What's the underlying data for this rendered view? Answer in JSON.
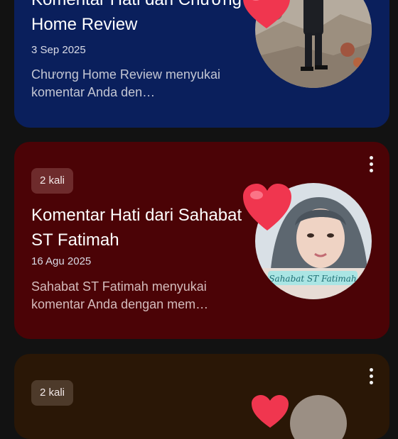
{
  "notifications": [
    {
      "title": "Komentar Hati dari Chương Home Review",
      "date": "3 Sep 2025",
      "description": "Chương Home Review menyukai komentar Anda den…",
      "avatar_icon": "avatar-man-on-rubble",
      "accent": "#0a1f5c"
    },
    {
      "badge": "2 kali",
      "title": "Komentar Hati dari Sahabat ST Fatimah",
      "date": "16 Agu 2025",
      "description": "Sahabat ST Fatimah menyukai komentar Anda dengan mem…",
      "avatar_caption": "Sahabat ST Fatimah",
      "avatar_icon": "avatar-woman-hijab",
      "accent": "#4b0306"
    },
    {
      "badge": "2 kali",
      "accent": "#2a1706"
    }
  ],
  "icons": {
    "more": "more-vertical-icon",
    "heart": "heart-icon"
  }
}
